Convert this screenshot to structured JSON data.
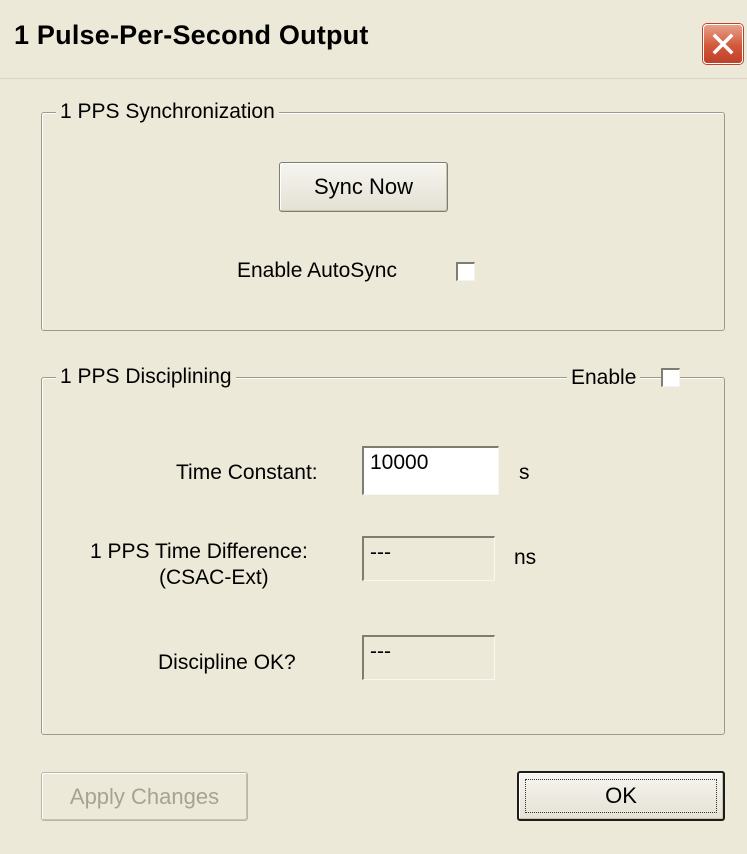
{
  "window": {
    "title": "1 Pulse-Per-Second Output"
  },
  "sync_group": {
    "label": "1 PPS Synchronization",
    "sync_now_label": "Sync Now",
    "autosync_label": "Enable AutoSync",
    "autosync_checked": false
  },
  "discipline_group": {
    "label": "1 PPS Disciplining",
    "enable_label": "Enable",
    "enable_checked": false,
    "time_constant": {
      "label": "Time Constant:",
      "value": "10000",
      "unit": "s"
    },
    "time_difference": {
      "label_line1": "1 PPS Time Difference:",
      "label_line2": "(CSAC-Ext)",
      "value": "---",
      "unit": "ns"
    },
    "discipline_ok": {
      "label": "Discipline OK?",
      "value": "---"
    }
  },
  "footer": {
    "apply_label": "Apply Changes",
    "ok_label": "OK"
  }
}
